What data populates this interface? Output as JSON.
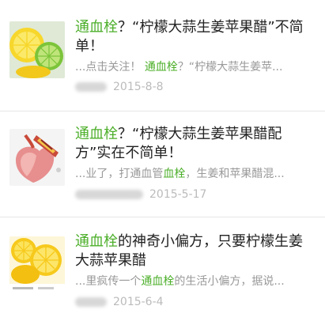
{
  "articles": [
    {
      "title_keyword": "通血栓",
      "title_rest": "？“柠檬大蒜生姜苹果醋”不简单！",
      "snippet_pre": "...点击关注！",
      "snippet_keyword": "通血栓",
      "snippet_post": "？“柠檬大蒜生姜苹...",
      "date": "2015-8-8",
      "thumbnail_icon": "lemon-lime-image"
    },
    {
      "title_keyword": "通血栓",
      "title_rest": "？“柠檬大蒜生姜苹果醋配方”实在不简单！",
      "snippet_pre": "...业了，打通血管",
      "snippet_keyword": "血栓",
      "snippet_post": "，生姜和苹果醋混...",
      "date": "2015-5-17",
      "thumbnail_icon": "artery-illustration-image"
    },
    {
      "title_keyword": "通血栓",
      "title_rest": "的神奇小偏方，只要柠檬生姜大蒜苹果醋",
      "snippet_pre": "...里疯传一个",
      "snippet_keyword": "通血栓",
      "snippet_post": "的生活小偏方，据说...",
      "date": "2015-6-4",
      "thumbnail_icon": "lemon-halves-image"
    }
  ],
  "colors": {
    "highlight": "#4caf2a",
    "title": "#222222",
    "snippet": "#999999",
    "date": "#bbbbbb",
    "divider": "#e6e6e6"
  }
}
